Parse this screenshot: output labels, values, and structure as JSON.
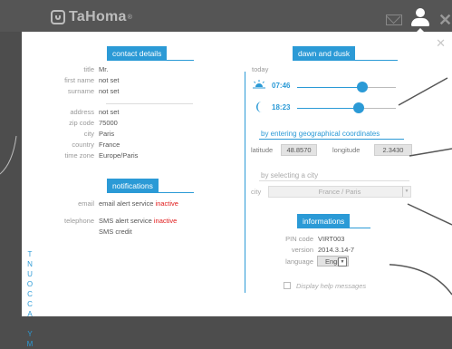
{
  "app": {
    "name": "TaHoma",
    "reg": "®"
  },
  "side_tab": {
    "label": "MY ACCOUNT"
  },
  "contact": {
    "heading": "contact details",
    "rows": [
      {
        "label": "title",
        "value": "Mr."
      },
      {
        "label": "first name",
        "value": "not set"
      },
      {
        "label": "surname",
        "value": "not set"
      },
      {
        "label": "address",
        "value": "not set"
      },
      {
        "label": "zip code",
        "value": "75000"
      },
      {
        "label": "city",
        "value": "Paris"
      },
      {
        "label": "country",
        "value": "France"
      },
      {
        "label": "time zone",
        "value": "Europe/Paris"
      }
    ]
  },
  "notifications": {
    "heading": "notifications",
    "email_label": "email",
    "email_text": "email alert service",
    "email_status": "inactive",
    "telephone_label": "telephone",
    "sms_text": "SMS alert service",
    "sms_status": "inactive",
    "sms_credit": "SMS credit"
  },
  "dawn": {
    "heading": "dawn and dusk",
    "today": "today",
    "sunrise": "07:46",
    "sunset": "18:23",
    "by_coords": "by entering geographical coordinates",
    "latitude_label": "latitude",
    "latitude": "48.8570",
    "longitude_label": "longitude",
    "longitude": "2.3430",
    "by_city": "by selecting a city",
    "city_label": "city",
    "city_value": "France / Paris"
  },
  "info": {
    "heading": "informations",
    "pin_label": "PIN code",
    "pin": "VIRT003",
    "version_label": "version",
    "version": "2014.3.14-7",
    "language_label": "language",
    "language": "English"
  },
  "help_text": "Display help messages",
  "icons": {
    "logo": "house-logo-icon",
    "mail": "mail-icon",
    "user": "user-icon",
    "close": "close-icon",
    "sunrise": "sunrise-icon",
    "moon": "moon-icon"
  },
  "colors": {
    "accent": "#2b9ad6",
    "inactive": "#e01a1a",
    "topbar": "#555555"
  }
}
